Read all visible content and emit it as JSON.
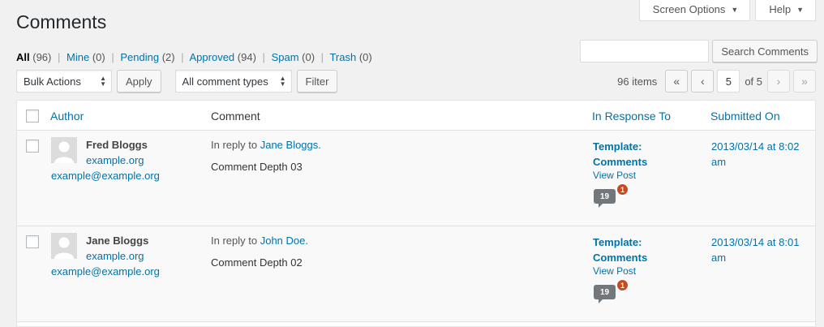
{
  "header": {
    "title": "Comments",
    "screen_options": "Screen Options",
    "help": "Help"
  },
  "filters": [
    {
      "label": "All",
      "count": "(96)"
    },
    {
      "label": "Mine",
      "count": "(0)"
    },
    {
      "label": "Pending",
      "count": "(2)"
    },
    {
      "label": "Approved",
      "count": "(94)"
    },
    {
      "label": "Spam",
      "count": "(0)"
    },
    {
      "label": "Trash",
      "count": "(0)"
    }
  ],
  "search": {
    "value": "",
    "button": "Search Comments"
  },
  "toolbar": {
    "bulk_actions": "Bulk Actions",
    "apply": "Apply",
    "comment_types": "All comment types",
    "filter": "Filter"
  },
  "pagination": {
    "items": "96 items",
    "first": "«",
    "prev": "‹",
    "current": "5",
    "of": "of 5",
    "next": "›",
    "last": "»"
  },
  "columns": {
    "author": "Author",
    "comment": "Comment",
    "response": "In Response To",
    "submitted": "Submitted On"
  },
  "rows": [
    {
      "author_name": "Fred Bloggs",
      "author_url": "example.org",
      "author_email": "example@example.org",
      "in_reply_prefix": "In reply to",
      "in_reply_name": "Jane Bloggs.",
      "comment": "Comment Depth 03",
      "response_title_1": "Template:",
      "response_title_2": "Comments",
      "view_post": "View Post",
      "comment_count": "19",
      "pending_count": "1",
      "submitted_1": "2013/03/14 at 8:02",
      "submitted_2": "am"
    },
    {
      "author_name": "Jane Bloggs",
      "author_url": "example.org",
      "author_email": "example@example.org",
      "in_reply_prefix": "In reply to",
      "in_reply_name": "John Doe.",
      "comment": "Comment Depth 02",
      "response_title_1": "Template:",
      "response_title_2": "Comments",
      "view_post": "View Post",
      "comment_count": "19",
      "pending_count": "1",
      "submitted_1": "2013/03/14 at 8:01",
      "submitted_2": "am"
    }
  ],
  "colors": {
    "link": "#0073aa",
    "pending_badge": "#ca4a1f",
    "bubble": "#72777c"
  }
}
